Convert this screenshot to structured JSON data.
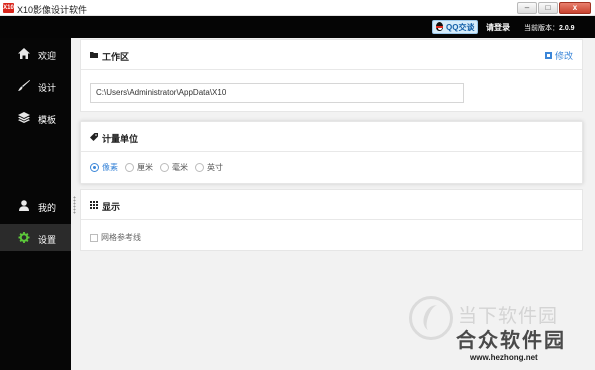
{
  "window": {
    "app_icon_text": "X10",
    "title": "X10影像设计软件",
    "minimize": "–",
    "maximize": "□",
    "close": "x"
  },
  "header": {
    "qq_label": "QQ交谈",
    "login_label": "请登录",
    "version_label": "当前版本：",
    "version_value": "2.0.9"
  },
  "sidebar": {
    "items": [
      {
        "label": "欢迎",
        "icon": "home-icon"
      },
      {
        "label": "设计",
        "icon": "brush-icon"
      },
      {
        "label": "模板",
        "icon": "layers-icon"
      },
      {
        "label": "我的",
        "icon": "user-icon"
      },
      {
        "label": "设置",
        "icon": "gear-icon",
        "active": true
      }
    ]
  },
  "workspace": {
    "title": "工作区",
    "edit_label": "修改",
    "path_value": "C:\\Users\\Administrator\\AppData\\X10"
  },
  "units": {
    "title": "计量单位",
    "options": [
      "像素",
      "厘米",
      "毫米",
      "英寸"
    ],
    "selected": "像素"
  },
  "display": {
    "title": "显示",
    "grid_label": "网格参考线",
    "grid_checked": false
  },
  "watermark": {
    "line1": "当下软件园",
    "line2": "合众软件园",
    "url": "www.hezhong.net"
  },
  "colors": {
    "accent": "#3b86d8",
    "sidebar_bg": "#060606",
    "sidebar_active": "#2b2b2b",
    "content_bg": "#f2f2f2"
  }
}
